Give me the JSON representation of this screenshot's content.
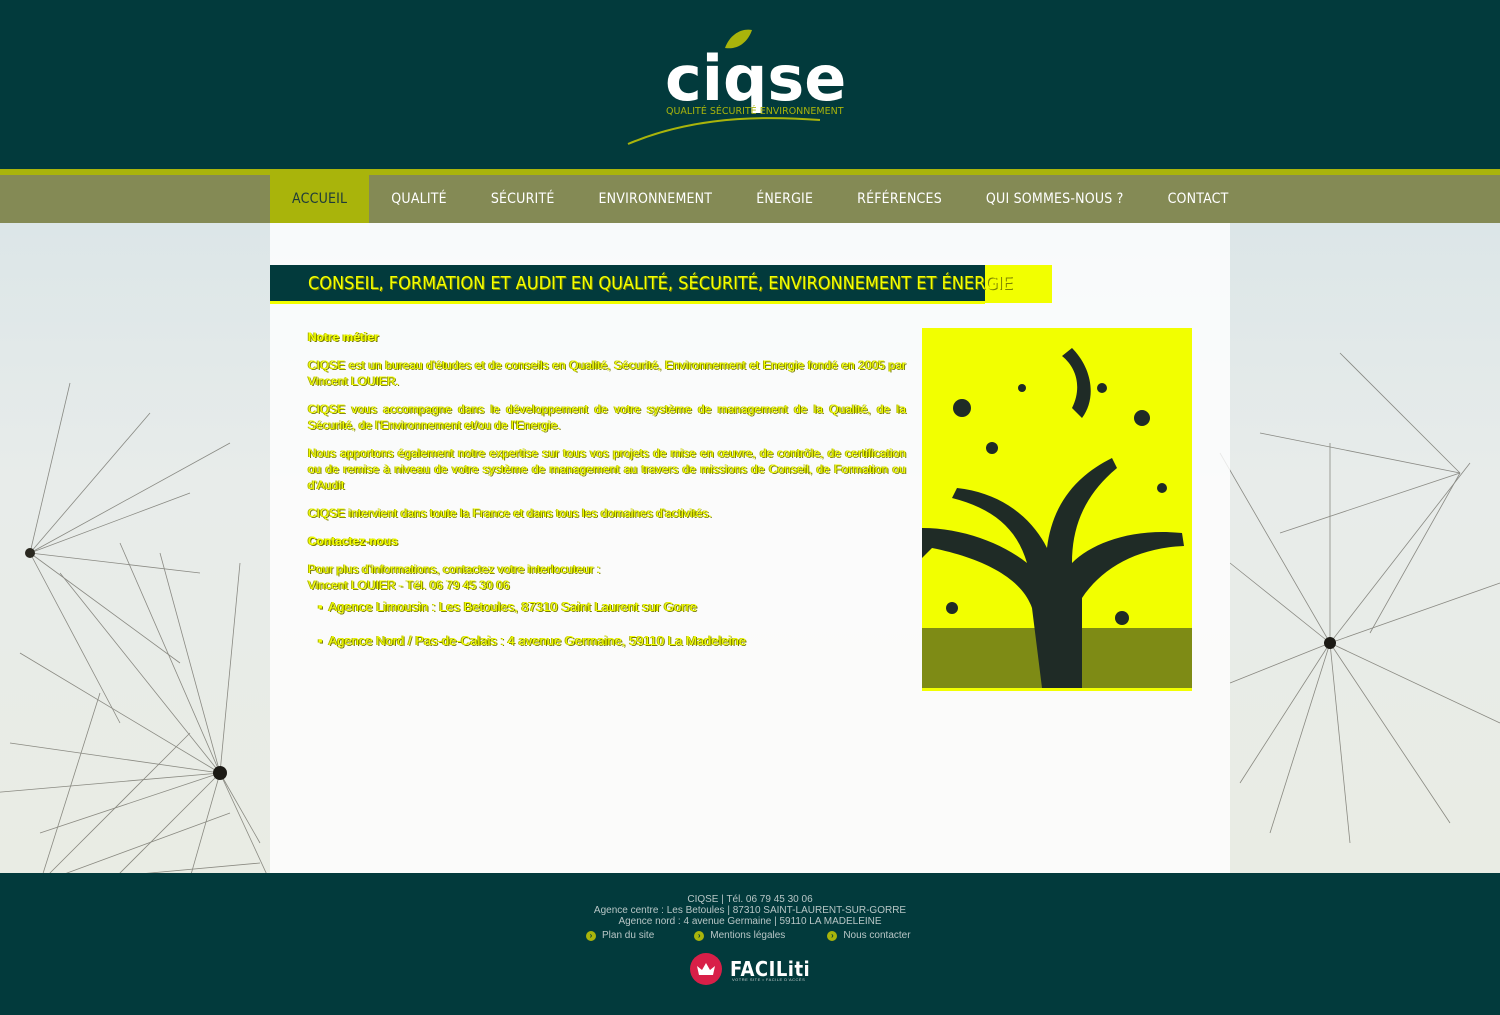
{
  "brand": {
    "name": "ciqse",
    "tagline": "QUALITÉ SÉCURITÉ ENVIRONNEMENT",
    "colors": {
      "dark": "#023a3c",
      "lime": "#a9b40b",
      "nav": "#848a55",
      "highlight": "#f2ff00"
    }
  },
  "nav": {
    "items": [
      {
        "label": "ACCUEIL",
        "active": true
      },
      {
        "label": "QUALITÉ"
      },
      {
        "label": "SÉCURITÉ"
      },
      {
        "label": "ENVIRONNEMENT"
      },
      {
        "label": "ÉNERGIE"
      },
      {
        "label": "RÉFÉRENCES"
      },
      {
        "label": "QUI SOMMES-NOUS ?"
      },
      {
        "label": "CONTACT"
      }
    ]
  },
  "main": {
    "title": "CONSEIL, FORMATION ET AUDIT EN QUALITÉ, SÉCURITÉ, ENVIRONNEMENT ET ÉNERGIE",
    "heading_metier": "Notre métier",
    "para1": "CIQSE est un bureau d'études et de conseils en Qualité, Sécurité, Environnement et Energie fondé en 2005 par Vincent LOUIER.",
    "para2": "CIQSE vous accompagne dans le développement de votre système de management de la Qualité, de la Sécurité, de l'Environnement et/ou de l'Energie.",
    "para3": "Nous apportons également notre expertise sur tous vos projets de mise en œuvre, de contrôle, de certification ou de remise à niveau de votre système de management au travers de missions de Conseil, de Formation ou d'Audit",
    "para4": "CIQSE intervient dans toute la France et dans tous les domaines d'activités.",
    "heading_contact": "Contactez-nous",
    "contact_intro": "Pour plus d'informations, contactez votre interlocuteur :",
    "contact_person": "Vincent LOUIER - Tél. 06 79 45 30 06",
    "agencies": [
      "Agence Limousin : Les Betoules, 87310 Saint Laurent sur Gorre",
      "Agence Nord / Pas-de-Calais : 4 avenue Germaine, 59110 La Madeleine"
    ]
  },
  "footer": {
    "line1": "CIQSE | Tél. 06 79 45 30 06",
    "line2": "Agence centre : Les Betoules | 87310 SAINT-LAURENT-SUR-GORRE",
    "line3": "Agence nord : 4 avenue Germaine | 59110 LA MADELEINE",
    "links": [
      {
        "label": "Plan du site",
        "icon": "arrow-right-icon"
      },
      {
        "label": "Mentions légales",
        "icon": "arrow-right-icon"
      },
      {
        "label": "Nous contacter",
        "icon": "arrow-right-icon"
      }
    ],
    "faciliti_name": "FACILiti",
    "faciliti_tagline": "VOTRE SITE • FACILE D'ACCÈS"
  }
}
